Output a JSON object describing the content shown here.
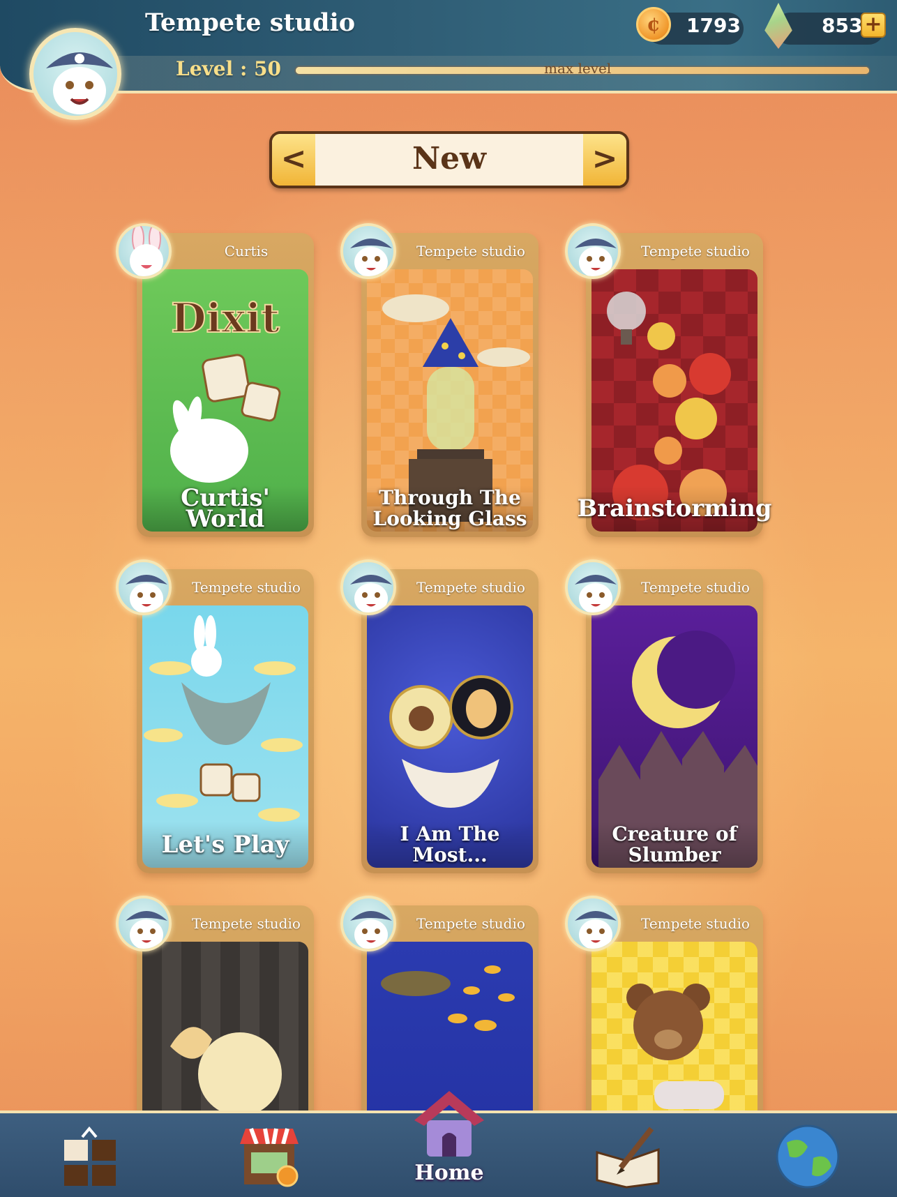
{
  "header": {
    "player_name": "Tempete studio",
    "level_label": "Level : 50",
    "level_progress": 1.0,
    "max_level_text": "max level",
    "coins": "1793",
    "gems": "853",
    "coin_symbol": "¢",
    "plus_symbol": "+"
  },
  "selector": {
    "title": "New",
    "prev_symbol": "<",
    "next_symbol": ">"
  },
  "cards": [
    {
      "author": "Curtis",
      "title": "Curtis' World",
      "art_text": "Dixit"
    },
    {
      "author": "Tempete studio",
      "title": "Through The Looking Glass"
    },
    {
      "author": "Tempete studio",
      "title": "Brainstorming"
    },
    {
      "author": "Tempete studio",
      "title": "Let's Play"
    },
    {
      "author": "Tempete studio",
      "title": "I Am The Most..."
    },
    {
      "author": "Tempete studio",
      "title": "Creature of Slumber"
    },
    {
      "author": "Tempete studio",
      "title": ""
    },
    {
      "author": "Tempete studio",
      "title": ""
    },
    {
      "author": "Tempete studio",
      "title": ""
    }
  ],
  "bottom_nav": {
    "home_label": "Home",
    "items": [
      "collection-icon",
      "shop-icon",
      "home-icon",
      "journal-icon",
      "globe-icon"
    ]
  },
  "colors": {
    "header_bg": "#2f5d75",
    "accent_gold": "#f1b537",
    "nav_bg": "#2f4d6c"
  }
}
